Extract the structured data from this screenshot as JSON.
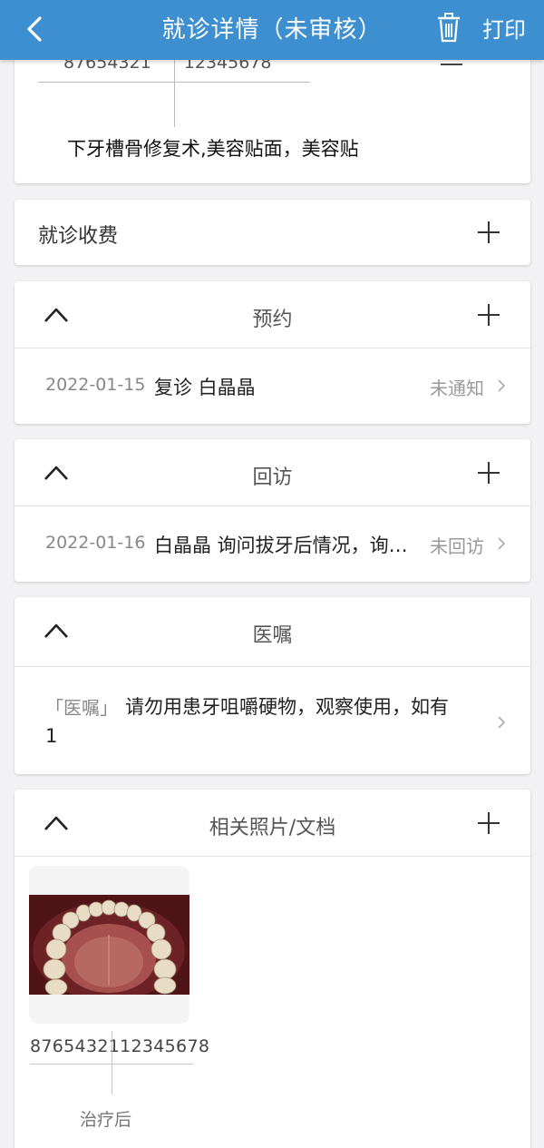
{
  "header": {
    "title": "就诊详情（未审核）",
    "print_label": "打印",
    "back_icon": "chevron-left-icon",
    "delete_icon": "trash-icon"
  },
  "record": {
    "tooth_left": "87654321",
    "tooth_right": "12345678",
    "diagnosis": "下牙槽骨修复术,美容贴面，美容贴"
  },
  "fees": {
    "label": "就诊收费"
  },
  "appointment": {
    "title": "预约",
    "date": "2022-01-15",
    "text": "复诊 白晶晶",
    "status": "未通知"
  },
  "followup": {
    "title": "回访",
    "date": "2022-01-16",
    "text": "白晶晶 询问拔牙后情况，询…",
    "status": "未回访"
  },
  "advice": {
    "title": "医嘱",
    "tag": "「医嘱」",
    "line1": "请勿用患牙咀嚼硬物，观察使用，如有",
    "line2": "1"
  },
  "photos": {
    "title": "相关照片/文档",
    "items": [
      {
        "tooth_left": "87654321",
        "tooth_right": "12345678",
        "caption": "治疗后"
      }
    ]
  },
  "colors": {
    "header_bg": "#3d8fd0",
    "page_bg": "#f2f2f4"
  }
}
